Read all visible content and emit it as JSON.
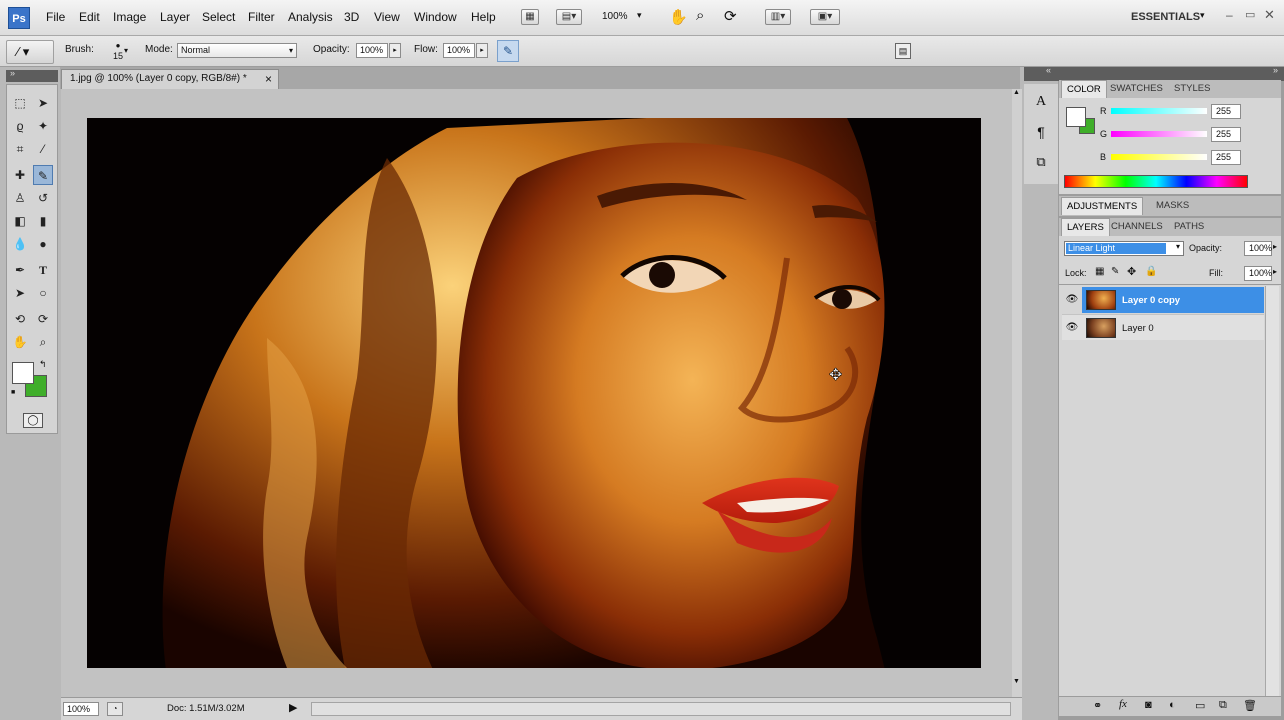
{
  "app": {
    "logo": "Ps"
  },
  "menu": {
    "items": [
      "File",
      "Edit",
      "Image",
      "Layer",
      "Select",
      "Filter",
      "Analysis",
      "3D",
      "View",
      "Window",
      "Help"
    ],
    "zoom": "100%",
    "workspace": "ESSENTIALS"
  },
  "options_bar": {
    "brush_label": "Brush:",
    "brush_size": "15",
    "mode_label": "Mode:",
    "mode_value": "Normal",
    "opacity_label": "Opacity:",
    "opacity_value": "100%",
    "flow_label": "Flow:",
    "flow_value": "100%"
  },
  "document": {
    "tab_title": "1.jpg @ 100% (Layer 0 copy, RGB/8#) *",
    "close_glyph": "×"
  },
  "status": {
    "zoom": "100%",
    "doc_size": "Doc: 1.51M/3.02M"
  },
  "color_panel": {
    "tabs": [
      "COLOR",
      "SWATCHES",
      "STYLES"
    ],
    "channels": [
      {
        "label": "R",
        "value": "255"
      },
      {
        "label": "G",
        "value": "255"
      },
      {
        "label": "B",
        "value": "255"
      }
    ],
    "foreground": "#ffffff",
    "background": "#3fae2a"
  },
  "adjustments_panel": {
    "tabs": [
      "ADJUSTMENTS",
      "MASKS"
    ]
  },
  "layers_panel": {
    "tabs": [
      "LAYERS",
      "CHANNELS",
      "PATHS"
    ],
    "blend_mode": "Linear Light",
    "opacity_label": "Opacity:",
    "opacity_value": "100%",
    "lock_label": "Lock:",
    "fill_label": "Fill:",
    "fill_value": "100%",
    "layers": [
      {
        "name": "Layer 0 copy",
        "selected": true
      },
      {
        "name": "Layer 0",
        "selected": false
      }
    ],
    "footer_icons": [
      "link-icon",
      "fx-icon",
      "mask-icon",
      "adjustment-icon",
      "group-icon",
      "new-layer-icon",
      "trash-icon"
    ]
  },
  "colors": {
    "selection_blue": "#3d8fe6",
    "foreground_swatch": "#ffffff",
    "background_swatch": "#3fae2a"
  }
}
